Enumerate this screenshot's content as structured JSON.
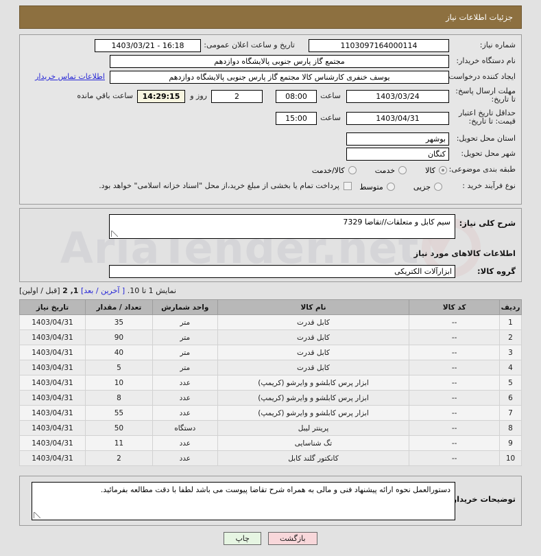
{
  "header": {
    "title": "جزئیات اطلاعات نیاز"
  },
  "form": {
    "need_number_label": "شماره نیاز:",
    "need_number_value": "1103097164000114",
    "announce_label": "تاریخ و ساعت اعلان عمومی:",
    "announce_value": "16:18 - 1403/03/21",
    "buyer_org_label": "نام دستگاه خریدار:",
    "buyer_org_value": "مجتمع گاز پارس جنوبی  پالایشگاه دوازدهم",
    "creator_label": "ایجاد کننده درخواست:",
    "creator_value": "یوسف خنفری کارشناس کالا مجتمع گاز پارس جنوبی  پالایشگاه دوازدهم",
    "contact_link": "اطلاعات تماس خریدار",
    "deadline_label": "مهلت ارسال پاسخ: تا تاریخ:",
    "deadline_date": "1403/03/24",
    "deadline_hour_label": "ساعت",
    "deadline_hour": "08:00",
    "remaining_days": "2",
    "remaining_days_label": "روز و",
    "remaining_time": "14:29:15",
    "remaining_time_label": "ساعت باقي مانده",
    "price_validity_label": "حداقل تاریخ اعتبار قیمت: تا تاریخ:",
    "price_validity_date": "1403/04/31",
    "price_validity_hour_label": "ساعت",
    "price_validity_hour": "15:00",
    "province_label": "استان محل تحویل:",
    "province_value": "بوشهر",
    "city_label": "شهر محل تحویل:",
    "city_value": "کنگان",
    "subject_class_label": "طبقه بندی موضوعی:",
    "subject_options": [
      {
        "label": "کالا",
        "selected": true
      },
      {
        "label": "خدمت",
        "selected": false
      },
      {
        "label": "کالا/خدمت",
        "selected": false
      }
    ],
    "process_type_label": "نوع فرآیند خرید :",
    "process_options": [
      {
        "label": "جزیی",
        "selected": false
      },
      {
        "label": "متوسط",
        "selected": false
      }
    ],
    "treasury_checkbox_label": "پرداخت تمام یا بخشی از مبلغ خرید،از محل \"اسناد خزانه اسلامی\" خواهد بود.",
    "treasury_checked": false
  },
  "description": {
    "label": "شرح کلی نیاز:",
    "value": "سیم کابل و متعلقات//تقاضا 7329"
  },
  "goods": {
    "section_title": "اطلاعات کالاهای مورد نیاز",
    "group_label": "گروه کالا:",
    "group_value": "ابزارآلات الکتریکی"
  },
  "pagination": {
    "showing": "نمایش 1 تا 10.",
    "last_next": "[ آخرین / بعد]",
    "pages": "1, 2",
    "prev_first": "[قبل / اولین]"
  },
  "table": {
    "columns": [
      "ردیف",
      "کد کالا",
      "نام کالا",
      "واحد شمارش",
      "تعداد / مقدار",
      "تاریخ نیاز"
    ],
    "rows": [
      {
        "row": "1",
        "code": "--",
        "name": "کابل قدرت",
        "unit": "متر",
        "qty": "35",
        "date": "1403/04/31"
      },
      {
        "row": "2",
        "code": "--",
        "name": "کابل قدرت",
        "unit": "متر",
        "qty": "90",
        "date": "1403/04/31"
      },
      {
        "row": "3",
        "code": "--",
        "name": "کابل قدرت",
        "unit": "متر",
        "qty": "40",
        "date": "1403/04/31"
      },
      {
        "row": "4",
        "code": "--",
        "name": "کابل قدرت",
        "unit": "متر",
        "qty": "5",
        "date": "1403/04/31"
      },
      {
        "row": "5",
        "code": "--",
        "name": "ابزار پرس کابلشو و وایرشو (کریمپ)",
        "unit": "عدد",
        "qty": "10",
        "date": "1403/04/31"
      },
      {
        "row": "6",
        "code": "--",
        "name": "ابزار پرس کابلشو و وایرشو (کریمپ)",
        "unit": "عدد",
        "qty": "8",
        "date": "1403/04/31"
      },
      {
        "row": "7",
        "code": "--",
        "name": "ابزار پرس کابلشو و وایرشو (کریمپ)",
        "unit": "عدد",
        "qty": "55",
        "date": "1403/04/31"
      },
      {
        "row": "8",
        "code": "--",
        "name": "پرینتر لیبل",
        "unit": "دستگاه",
        "qty": "50",
        "date": "1403/04/31"
      },
      {
        "row": "9",
        "code": "--",
        "name": "تگ شناسایی",
        "unit": "عدد",
        "qty": "11",
        "date": "1403/04/31"
      },
      {
        "row": "10",
        "code": "--",
        "name": "کانکتور گلند کابل",
        "unit": "عدد",
        "qty": "2",
        "date": "1403/04/31"
      }
    ]
  },
  "notes": {
    "label": "توضیحات خریدار:",
    "value": "دستورالعمل نحوه ارائه پیشنهاد فنی و مالی به همراه شرح تقاضا پیوست می باشد لطفا با دقت  مطالعه بفرمائید."
  },
  "footer": {
    "print_label": "چاپ",
    "back_label": "بازگشت"
  },
  "watermark": {
    "text": "AriaTender.net"
  },
  "colors": {
    "header_bg": "#8d7040",
    "page_bg": "#e2e2e2",
    "link": "#2727d6",
    "table_header_bg": "#b8b8b8",
    "print_btn_bg": "#e6f5e2",
    "back_btn_bg": "#f8d7da",
    "timer_bg": "#f7f5e0"
  }
}
